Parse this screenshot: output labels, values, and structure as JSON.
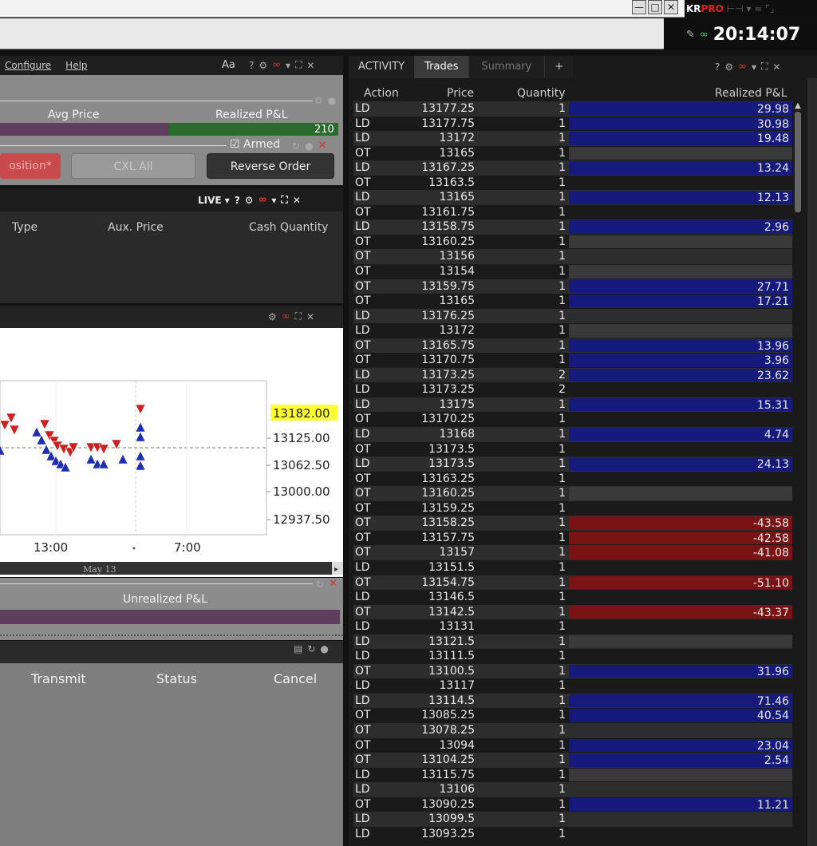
{
  "window": {
    "brand_a": "KR",
    "brand_b": "PRO",
    "brand_extra": "⊢⊣ ▾  = ⌜⌟",
    "clock": "20:14:07",
    "min_glyph": "—",
    "max_glyph": "□",
    "close_glyph": "✕"
  },
  "menu": {
    "configure": "Configure",
    "help": "Help",
    "aa": "Aa"
  },
  "position": {
    "avg_price_label": "Avg Price",
    "realized_label": "Realized P&L",
    "realized_value": "210",
    "armed_label": "Armed",
    "btn_position": "osition*",
    "btn_cxl": "CXL All",
    "btn_reverse": "Reverse Order"
  },
  "orders": {
    "live_label": "LIVE",
    "col_type": "Type",
    "col_aux": "Aux. Price",
    "col_cash": "Cash Quantity"
  },
  "chart_data": {
    "type": "scatter",
    "y_ticks": [
      "13182.00",
      "13125.00",
      "13062.50",
      "13000.00",
      "12937.50"
    ],
    "current_price": "13182.00",
    "x_ticks": [
      "13:00",
      "7:00"
    ],
    "date_label": "May 13"
  },
  "unrealized": {
    "label": "Unrealized P&L"
  },
  "transmit": {
    "col_transmit": "Transmit",
    "col_status": "Status",
    "col_cancel": "Cancel"
  },
  "trades": {
    "tabs": [
      {
        "label": "ACTIVITY"
      },
      {
        "label": "Trades"
      },
      {
        "label": "Summary"
      },
      {
        "label": "+"
      }
    ],
    "headers": {
      "action": "Action",
      "price": "Price",
      "quantity": "Quantity",
      "pnl": "Realized P&L"
    },
    "rows": [
      {
        "a": "LD",
        "p": "13177.25",
        "q": "1",
        "v": "29.98",
        "c": "blue"
      },
      {
        "a": "LD",
        "p": "13177.75",
        "q": "1",
        "v": "30.98",
        "c": "blue"
      },
      {
        "a": "LD",
        "p": "13172",
        "q": "1",
        "v": "19.48",
        "c": "blue"
      },
      {
        "a": "OT",
        "p": "13165",
        "q": "1",
        "v": "",
        "c": "grey"
      },
      {
        "a": "LD",
        "p": "13167.25",
        "q": "1",
        "v": "13.24",
        "c": "blue"
      },
      {
        "a": "OT",
        "p": "13163.5",
        "q": "1",
        "v": "",
        "c": ""
      },
      {
        "a": "LD",
        "p": "13165",
        "q": "1",
        "v": "12.13",
        "c": "blue"
      },
      {
        "a": "OT",
        "p": "13161.75",
        "q": "1",
        "v": "",
        "c": ""
      },
      {
        "a": "LD",
        "p": "13158.75",
        "q": "1",
        "v": "2.96",
        "c": "blue"
      },
      {
        "a": "OT",
        "p": "13160.25",
        "q": "1",
        "v": "",
        "c": "grey"
      },
      {
        "a": "OT",
        "p": "13156",
        "q": "1",
        "v": "",
        "c": ""
      },
      {
        "a": "OT",
        "p": "13154",
        "q": "1",
        "v": "",
        "c": "grey"
      },
      {
        "a": "OT",
        "p": "13159.75",
        "q": "1",
        "v": "27.71",
        "c": "blue"
      },
      {
        "a": "OT",
        "p": "13165",
        "q": "1",
        "v": "17.21",
        "c": "blue"
      },
      {
        "a": "LD",
        "p": "13176.25",
        "q": "1",
        "v": "",
        "c": ""
      },
      {
        "a": "LD",
        "p": "13172",
        "q": "1",
        "v": "",
        "c": "grey"
      },
      {
        "a": "OT",
        "p": "13165.75",
        "q": "1",
        "v": "13.96",
        "c": "blue"
      },
      {
        "a": "OT",
        "p": "13170.75",
        "q": "1",
        "v": "3.96",
        "c": "blue"
      },
      {
        "a": "LD",
        "p": "13173.25",
        "q": "2",
        "v": "23.62",
        "c": "blue"
      },
      {
        "a": "LD",
        "p": "13173.25",
        "q": "2",
        "v": "",
        "c": ""
      },
      {
        "a": "LD",
        "p": "13175",
        "q": "1",
        "v": "15.31",
        "c": "blue"
      },
      {
        "a": "OT",
        "p": "13170.25",
        "q": "1",
        "v": "",
        "c": ""
      },
      {
        "a": "LD",
        "p": "13168",
        "q": "1",
        "v": "4.74",
        "c": "blue"
      },
      {
        "a": "OT",
        "p": "13173.5",
        "q": "1",
        "v": "",
        "c": ""
      },
      {
        "a": "LD",
        "p": "13173.5",
        "q": "1",
        "v": "24.13",
        "c": "blue"
      },
      {
        "a": "OT",
        "p": "13163.25",
        "q": "1",
        "v": "",
        "c": ""
      },
      {
        "a": "OT",
        "p": "13160.25",
        "q": "1",
        "v": "",
        "c": "grey"
      },
      {
        "a": "OT",
        "p": "13159.25",
        "q": "1",
        "v": "",
        "c": ""
      },
      {
        "a": "OT",
        "p": "13158.25",
        "q": "1",
        "v": "-43.58",
        "c": "red"
      },
      {
        "a": "OT",
        "p": "13157.75",
        "q": "1",
        "v": "-42.58",
        "c": "red"
      },
      {
        "a": "OT",
        "p": "13157",
        "q": "1",
        "v": "-41.08",
        "c": "red"
      },
      {
        "a": "LD",
        "p": "13151.5",
        "q": "1",
        "v": "",
        "c": ""
      },
      {
        "a": "OT",
        "p": "13154.75",
        "q": "1",
        "v": "-51.10",
        "c": "red"
      },
      {
        "a": "LD",
        "p": "13146.5",
        "q": "1",
        "v": "",
        "c": ""
      },
      {
        "a": "OT",
        "p": "13142.5",
        "q": "1",
        "v": "-43.37",
        "c": "red"
      },
      {
        "a": "LD",
        "p": "13131",
        "q": "1",
        "v": "",
        "c": ""
      },
      {
        "a": "LD",
        "p": "13121.5",
        "q": "1",
        "v": "",
        "c": "grey"
      },
      {
        "a": "LD",
        "p": "13111.5",
        "q": "1",
        "v": "",
        "c": ""
      },
      {
        "a": "OT",
        "p": "13100.5",
        "q": "1",
        "v": "31.96",
        "c": "blue"
      },
      {
        "a": "LD",
        "p": "13117",
        "q": "1",
        "v": "",
        "c": ""
      },
      {
        "a": "LD",
        "p": "13114.5",
        "q": "1",
        "v": "71.46",
        "c": "blue"
      },
      {
        "a": "OT",
        "p": "13085.25",
        "q": "1",
        "v": "40.54",
        "c": "blue"
      },
      {
        "a": "OT",
        "p": "13078.25",
        "q": "1",
        "v": "",
        "c": ""
      },
      {
        "a": "OT",
        "p": "13094",
        "q": "1",
        "v": "23.04",
        "c": "blue"
      },
      {
        "a": "OT",
        "p": "13104.25",
        "q": "1",
        "v": "2.54",
        "c": "blue"
      },
      {
        "a": "LD",
        "p": "13115.75",
        "q": "1",
        "v": "",
        "c": "grey"
      },
      {
        "a": "LD",
        "p": "13106",
        "q": "1",
        "v": "",
        "c": ""
      },
      {
        "a": "OT",
        "p": "13090.25",
        "q": "1",
        "v": "11.21",
        "c": "blue"
      },
      {
        "a": "LD",
        "p": "13099.5",
        "q": "1",
        "v": "",
        "c": ""
      },
      {
        "a": "LD",
        "p": "13093.25",
        "q": "1",
        "v": "",
        "c": ""
      }
    ]
  }
}
